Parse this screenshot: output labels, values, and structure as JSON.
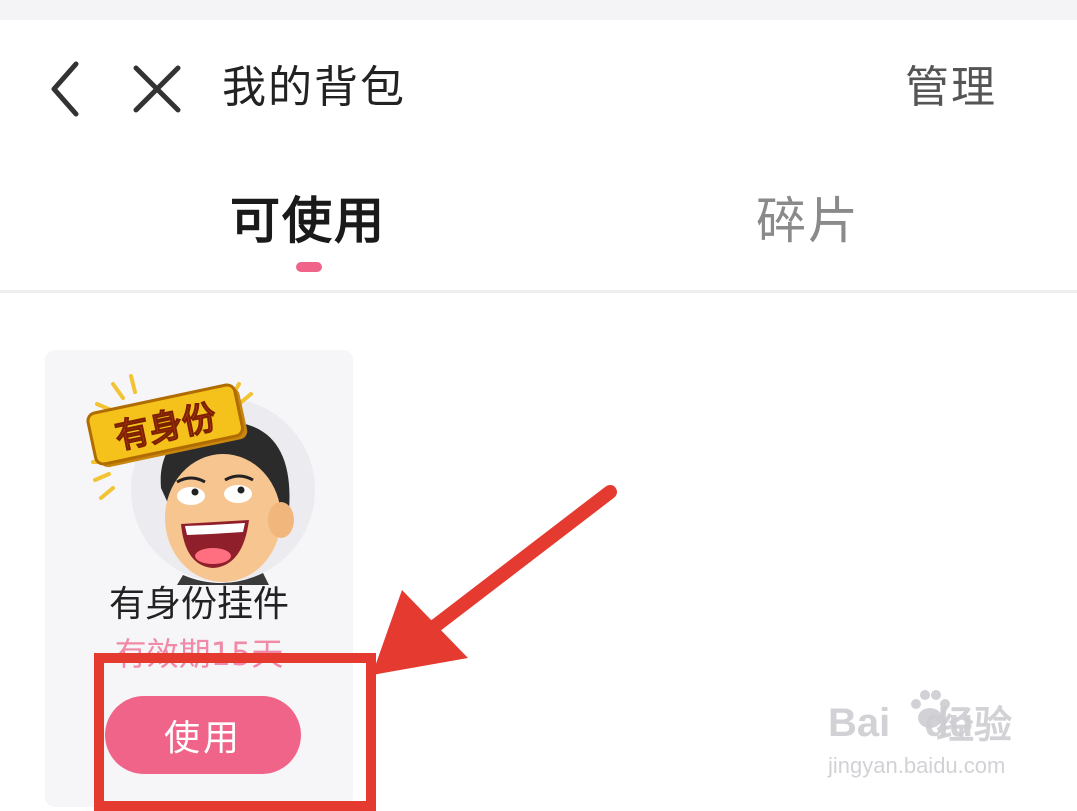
{
  "header": {
    "title": "我的背包",
    "manage_label": "管理"
  },
  "tabs": [
    {
      "label": "可使用",
      "active": true
    },
    {
      "label": "碎片",
      "active": false
    }
  ],
  "items": [
    {
      "name": "有身份挂件",
      "badge_text": "有身份",
      "expiry": "有效期15天",
      "action_label": "使用"
    }
  ],
  "watermark": {
    "brand": "Bai",
    "brand_suffix": "du",
    "brand_cn": "经验",
    "url": "jingyan.baidu.com"
  },
  "colors": {
    "accent_pink": "#f1648a",
    "expiry_pink": "#f08aa6",
    "annotation_red": "#e53a2f"
  },
  "icons": {
    "back": "chevron-left-icon",
    "close": "close-icon"
  }
}
